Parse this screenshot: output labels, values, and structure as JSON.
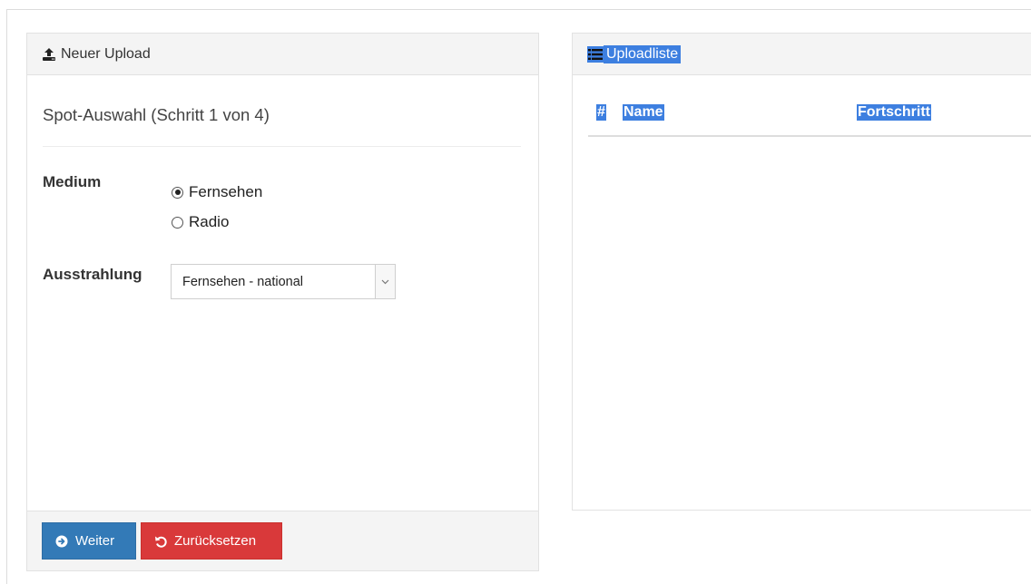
{
  "upload_panel": {
    "heading": "Neuer Upload",
    "heading_icon": "upload-icon",
    "step_title": "Spot-Auswahl (Schritt 1 von 4)",
    "medium": {
      "label": "Medium",
      "options": [
        {
          "label": "Fernsehen",
          "checked": true
        },
        {
          "label": "Radio",
          "checked": false
        }
      ]
    },
    "ausstrahlung": {
      "label": "Ausstrahlung",
      "selected": "Fernsehen - national"
    },
    "buttons": {
      "next_label": "Weiter",
      "next_icon": "arrow-circle-right-icon",
      "reset_label": "Zurücksetzen",
      "reset_icon": "undo-icon"
    }
  },
  "upload_list": {
    "heading": "Uploadliste",
    "heading_icon": "list-icon",
    "columns": [
      "#",
      "Name",
      "Fortschritt"
    ],
    "rows": []
  },
  "colors": {
    "primary": "#337ab7",
    "danger": "#d9393a",
    "selection_highlight": "#3d7fe0",
    "panel_heading_bg": "#f4f4f4"
  }
}
